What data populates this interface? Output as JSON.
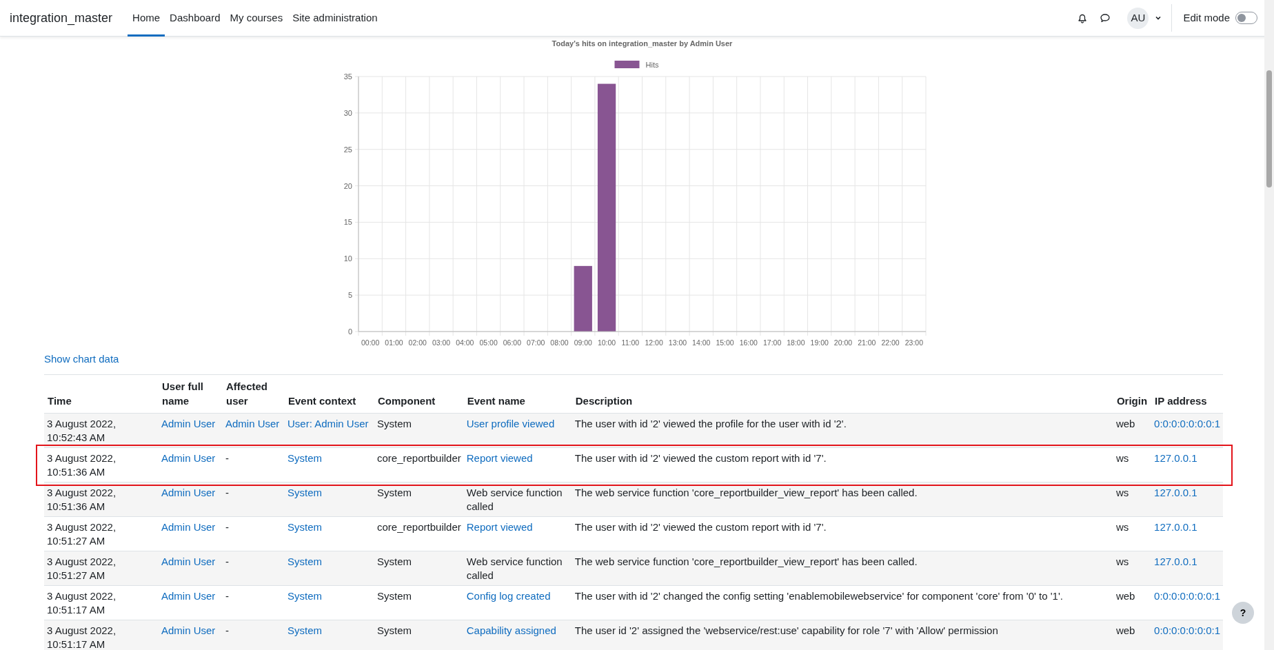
{
  "navbar": {
    "brand": "integration_master",
    "nav": [
      {
        "label": "Home",
        "selected": true
      },
      {
        "label": "Dashboard",
        "selected": false
      },
      {
        "label": "My courses",
        "selected": false
      },
      {
        "label": "Site administration",
        "selected": false
      }
    ],
    "user": {
      "initials": "AU"
    },
    "edit_mode": {
      "label": "Edit mode",
      "on": false
    }
  },
  "chart": {
    "chart_data": {
      "type": "bar",
      "title": "Today's hits on integration_master by Admin User",
      "categories": [
        "00:00",
        "01:00",
        "02:00",
        "03:00",
        "04:00",
        "05:00",
        "06:00",
        "07:00",
        "08:00",
        "09:00",
        "10:00",
        "11:00",
        "12:00",
        "13:00",
        "14:00",
        "15:00",
        "16:00",
        "17:00",
        "18:00",
        "19:00",
        "20:00",
        "21:00",
        "22:00",
        "23:00"
      ],
      "series": [
        {
          "name": "Hits",
          "color": "#885592",
          "values": [
            0,
            0,
            0,
            0,
            0,
            0,
            0,
            0,
            0,
            9,
            34,
            0,
            0,
            0,
            0,
            0,
            0,
            0,
            0,
            0,
            0,
            0,
            0,
            0
          ]
        }
      ],
      "grid": true,
      "ylim": [
        0,
        35
      ],
      "yticks": [
        0,
        5,
        10,
        15,
        20,
        25,
        30,
        35
      ]
    }
  },
  "show_chart_data": "Show chart data",
  "table": {
    "columns": [
      "Time",
      "User full name",
      "Affected user",
      "Event context",
      "Component",
      "Event name",
      "Description",
      "Origin",
      "IP address"
    ],
    "rows": [
      {
        "highlighted": false,
        "cells": [
          {
            "text": "3 August 2022, 10:52:43 AM",
            "link": false
          },
          {
            "text": "Admin User",
            "link": true
          },
          {
            "text": "Admin User",
            "link": true
          },
          {
            "text": "User: Admin User",
            "link": true
          },
          {
            "text": "System",
            "link": false
          },
          {
            "text": "User profile viewed",
            "link": true
          },
          {
            "text": "The user with id '2' viewed the profile for the user with id '2'.",
            "link": false
          },
          {
            "text": "web",
            "link": false
          },
          {
            "text": "0:0:0:0:0:0:0:1",
            "link": true
          }
        ]
      },
      {
        "highlighted": true,
        "cells": [
          {
            "text": "3 August 2022, 10:51:36 AM",
            "link": false
          },
          {
            "text": "Admin User",
            "link": true
          },
          {
            "text": "-",
            "link": false
          },
          {
            "text": "System",
            "link": true
          },
          {
            "text": "core_reportbuilder",
            "link": false
          },
          {
            "text": "Report viewed",
            "link": true
          },
          {
            "text": "The user with id '2' viewed the custom report with id '7'.",
            "link": false
          },
          {
            "text": "ws",
            "link": false
          },
          {
            "text": "127.0.0.1",
            "link": true
          }
        ]
      },
      {
        "highlighted": false,
        "cells": [
          {
            "text": "3 August 2022, 10:51:36 AM",
            "link": false
          },
          {
            "text": "Admin User",
            "link": true
          },
          {
            "text": "-",
            "link": false
          },
          {
            "text": "System",
            "link": true
          },
          {
            "text": "System",
            "link": false
          },
          {
            "text": "Web service function called",
            "link": false
          },
          {
            "text": "The web service function 'core_reportbuilder_view_report' has been called.",
            "link": false
          },
          {
            "text": "ws",
            "link": false
          },
          {
            "text": "127.0.0.1",
            "link": true
          }
        ]
      },
      {
        "highlighted": false,
        "cells": [
          {
            "text": "3 August 2022, 10:51:27 AM",
            "link": false
          },
          {
            "text": "Admin User",
            "link": true
          },
          {
            "text": "-",
            "link": false
          },
          {
            "text": "System",
            "link": true
          },
          {
            "text": "core_reportbuilder",
            "link": false
          },
          {
            "text": "Report viewed",
            "link": true
          },
          {
            "text": "The user with id '2' viewed the custom report with id '7'.",
            "link": false
          },
          {
            "text": "ws",
            "link": false
          },
          {
            "text": "127.0.0.1",
            "link": true
          }
        ]
      },
      {
        "highlighted": false,
        "cells": [
          {
            "text": "3 August 2022, 10:51:27 AM",
            "link": false
          },
          {
            "text": "Admin User",
            "link": true
          },
          {
            "text": "-",
            "link": false
          },
          {
            "text": "System",
            "link": true
          },
          {
            "text": "System",
            "link": false
          },
          {
            "text": "Web service function called",
            "link": false
          },
          {
            "text": "The web service function 'core_reportbuilder_view_report' has been called.",
            "link": false
          },
          {
            "text": "ws",
            "link": false
          },
          {
            "text": "127.0.0.1",
            "link": true
          }
        ]
      },
      {
        "highlighted": false,
        "cells": [
          {
            "text": "3 August 2022, 10:51:17 AM",
            "link": false
          },
          {
            "text": "Admin User",
            "link": true
          },
          {
            "text": "-",
            "link": false
          },
          {
            "text": "System",
            "link": true
          },
          {
            "text": "System",
            "link": false
          },
          {
            "text": "Config log created",
            "link": true
          },
          {
            "text": "The user with id '2' changed the config setting 'enablemobilewebservice' for component 'core' from '0' to '1'.",
            "link": false
          },
          {
            "text": "web",
            "link": false
          },
          {
            "text": "0:0:0:0:0:0:0:1",
            "link": true
          }
        ]
      },
      {
        "highlighted": false,
        "cells": [
          {
            "text": "3 August 2022, 10:51:17 AM",
            "link": false
          },
          {
            "text": "Admin User",
            "link": true
          },
          {
            "text": "-",
            "link": false
          },
          {
            "text": "System",
            "link": true
          },
          {
            "text": "System",
            "link": false
          },
          {
            "text": "Capability assigned",
            "link": true
          },
          {
            "text": "The user id '2' assigned the 'webservice/rest:use' capability for role '7' with 'Allow' permission",
            "link": false
          },
          {
            "text": "web",
            "link": false
          },
          {
            "text": "0:0:0:0:0:0:0:1",
            "link": true
          }
        ]
      }
    ]
  },
  "help_button": "?"
}
